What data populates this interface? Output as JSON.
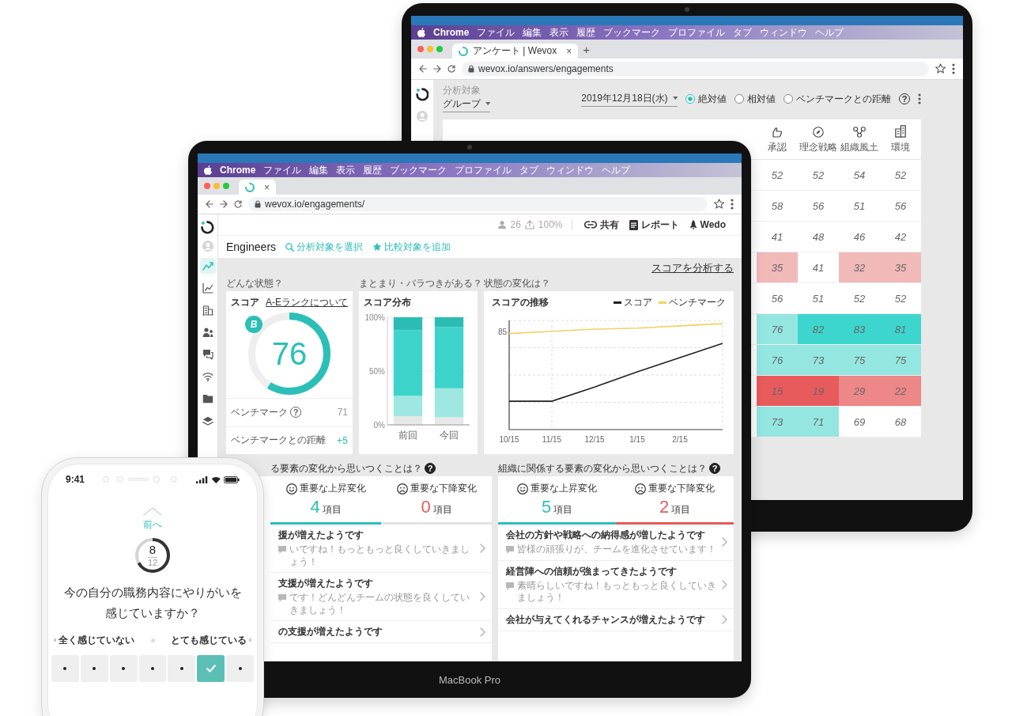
{
  "back_laptop": {
    "menu_bar": {
      "app": "Chrome",
      "items": [
        "ファイル",
        "編集",
        "表示",
        "履歴",
        "ブックマーク",
        "プロファイル",
        "タブ",
        "ウィンドウ",
        "ヘルプ"
      ]
    },
    "tab": {
      "title": "アンケート | Wevox",
      "close": "×"
    },
    "new_tab": "+",
    "address_bar": {
      "url": "wevox.io/answers/engagements"
    },
    "filter": {
      "label": "分析対象",
      "value": "グループ"
    },
    "date_picker": {
      "value": "2019年12月18日(水)"
    },
    "view_options": [
      {
        "label": "絶対値",
        "selected": true
      },
      {
        "label": "相対値",
        "selected": false
      },
      {
        "label": "ベンチマークとの距離",
        "selected": false
      }
    ],
    "view_help": "?",
    "table": {
      "columns": [
        "承認",
        "理念戦略",
        "組織風土",
        "環境"
      ],
      "rows": [
        {
          "cells": [
            {
              "value": "52",
              "color": "#ffffff"
            },
            {
              "value": "52",
              "color": "#ffffff"
            },
            {
              "value": "54",
              "color": "#ffffff"
            },
            {
              "value": "52",
              "color": "#ffffff"
            }
          ]
        },
        {
          "cells": [
            {
              "value": "58",
              "color": "#ffffff"
            },
            {
              "value": "56",
              "color": "#ffffff"
            },
            {
              "value": "51",
              "color": "#ffffff"
            },
            {
              "value": "56",
              "color": "#ffffff"
            }
          ]
        },
        {
          "cells": [
            {
              "value": "41",
              "color": "#ffffff"
            },
            {
              "value": "48",
              "color": "#ffffff"
            },
            {
              "value": "46",
              "color": "#ffffff"
            },
            {
              "value": "42",
              "color": "#ffffff"
            }
          ]
        },
        {
          "cells": [
            {
              "value": "35",
              "color": "#f2b9b9"
            },
            {
              "value": "41",
              "color": "#ffffff"
            },
            {
              "value": "32",
              "color": "#f2b9b9"
            },
            {
              "value": "35",
              "color": "#f2b9b9"
            }
          ]
        },
        {
          "cells": [
            {
              "value": "56",
              "color": "#ffffff"
            },
            {
              "value": "51",
              "color": "#ffffff"
            },
            {
              "value": "52",
              "color": "#ffffff"
            },
            {
              "value": "52",
              "color": "#ffffff"
            }
          ]
        },
        {
          "cells": [
            {
              "value": "76",
              "color": "#94e6e1"
            },
            {
              "value": "82",
              "color": "#3dd6cf"
            },
            {
              "value": "83",
              "color": "#3dd6cf"
            },
            {
              "value": "81",
              "color": "#3dd6cf"
            }
          ]
        },
        {
          "cells": [
            {
              "value": "76",
              "color": "#94e6e1"
            },
            {
              "value": "73",
              "color": "#94e6e1"
            },
            {
              "value": "75",
              "color": "#94e6e1"
            },
            {
              "value": "75",
              "color": "#94e6e1"
            }
          ]
        },
        {
          "cells": [
            {
              "value": "15",
              "color": "#e85b5c"
            },
            {
              "value": "19",
              "color": "#e85b5c"
            },
            {
              "value": "29",
              "color": "#ee8787"
            },
            {
              "value": "22",
              "color": "#ee8787"
            }
          ]
        },
        {
          "cells": [
            {
              "value": "73",
              "color": "#94e6e1"
            },
            {
              "value": "71",
              "color": "#94e6e1"
            },
            {
              "value": "69",
              "color": "#ffffff"
            },
            {
              "value": "68",
              "color": "#ffffff"
            }
          ]
        }
      ]
    }
  },
  "front_laptop": {
    "menu_bar": {
      "app": "Chrome",
      "items": [
        "ファイル",
        "編集",
        "表示",
        "履歴",
        "ブックマーク",
        "プロファイル",
        "タブ",
        "ウィンドウ",
        "ヘルプ"
      ]
    },
    "tab": {
      "close": "×"
    },
    "address_bar": {
      "url": "wevox.io/engagements/"
    },
    "sidebar": [
      {
        "selected": true
      },
      {
        "selected": false
      },
      {
        "selected": false
      },
      {
        "selected": false
      },
      {
        "selected": false
      },
      {
        "selected": false
      },
      {
        "selected": false
      },
      {
        "selected": false
      }
    ],
    "header": {
      "members": "26",
      "answer_rate": "100%",
      "actions": [
        "共有",
        "レポート",
        "Wedo"
      ]
    },
    "team": {
      "name": "Engineers",
      "links": [
        "分析対象を選択",
        "比較対象を追加"
      ]
    },
    "analyze_link": "スコアを分析する",
    "score_card": {
      "section": "どんな状態？",
      "title": "スコア",
      "rank_link": "A-Eランクについて",
      "grade": "B",
      "score": "76",
      "level": 0.59,
      "benchmark": {
        "label": "ベンチマーク",
        "help": "?",
        "value": "71"
      },
      "gap": {
        "label": "ベンチマークとの距離",
        "value": "+5"
      }
    },
    "distribution_card": {
      "section": "まとまり・バラつきがある？",
      "title": "スコア分布",
      "chart_data": {
        "type": "bar",
        "stacked": true,
        "categories": [
          "前回",
          "今回"
        ],
        "ylim": [
          0,
          100
        ],
        "yticks": [
          {
            "value": 0,
            "label": "0%"
          },
          {
            "value": 50,
            "label": "50%"
          },
          {
            "value": 100,
            "label": "100%"
          }
        ],
        "series": [
          {
            "color": "#e8e8e8",
            "values": [
              8,
              7
            ]
          },
          {
            "color": "#9fe7e1",
            "values": [
              19,
              27
            ]
          },
          {
            "color": "#3dd3ca",
            "values": [
              61,
              57
            ]
          },
          {
            "color": "#2bbdb4",
            "values": [
              12,
              9
            ]
          }
        ]
      }
    },
    "trend_card": {
      "section": "状態の変化は？",
      "title": "スコアの推移",
      "legend": [
        {
          "name": "スコア",
          "color": "#222222"
        },
        {
          "name": "ベンチマーク",
          "color": "#efd263"
        }
      ],
      "y_label": "85",
      "x_labels": [
        "10/15",
        "11/15",
        "12/15",
        "1/15",
        "2/15"
      ]
    },
    "change_panels": [
      {
        "question": "る要素の変化から思いつくことは？",
        "help": "?",
        "stats": [
          {
            "kind": "up",
            "label": "重要な上昇変化",
            "count": "4",
            "unit": "項目",
            "highlighted": true
          },
          {
            "kind": "down",
            "label": "重要な下降変化",
            "count": "0",
            "unit": "項目",
            "highlighted": false
          }
        ],
        "items": [
          {
            "title": "援が増えたようです",
            "comment": "いですね！もっともっと良くしていきましょう！"
          },
          {
            "title": "支援が増えたようです",
            "comment": "です！どんどんチームの状態を良くしていきましょう！"
          },
          {
            "title": "の支援が増えたようです"
          }
        ]
      },
      {
        "question": "組織に関係する要素の変化から思いつくことは？",
        "help": "?",
        "stats": [
          {
            "kind": "up",
            "label": "重要な上昇変化",
            "count": "5",
            "unit": "項目",
            "highlighted": true
          },
          {
            "kind": "down",
            "label": "重要な下降変化",
            "count": "2",
            "unit": "項目",
            "highlighted": true
          }
        ],
        "items": [
          {
            "title": "会社の方針や戦略への納得感が増したようです",
            "comment": "皆様の頑張りが、チームを進化させています！"
          },
          {
            "title": "経営陣への信頼が強まってきたようです",
            "comment": "素晴らしいですね！もっともっと良くしていきましょう！"
          },
          {
            "title": "会社が与えてくれるチャンスが増えたようです"
          }
        ]
      }
    ],
    "model_label": "MacBook Pro"
  },
  "phone": {
    "time": "9:41",
    "back_link": "前へ",
    "progress": {
      "current": "8",
      "total": "12",
      "level": 0.667
    },
    "question": "今の自分の職務内容にやりがいを感じていますか？",
    "scale": {
      "min_label": "全く感じていない",
      "max_label": "とても感じている"
    },
    "options": [
      {
        "selected": false
      },
      {
        "selected": false
      },
      {
        "selected": false
      },
      {
        "selected": false
      },
      {
        "selected": false
      },
      {
        "selected": true
      },
      {
        "selected": false
      }
    ]
  }
}
